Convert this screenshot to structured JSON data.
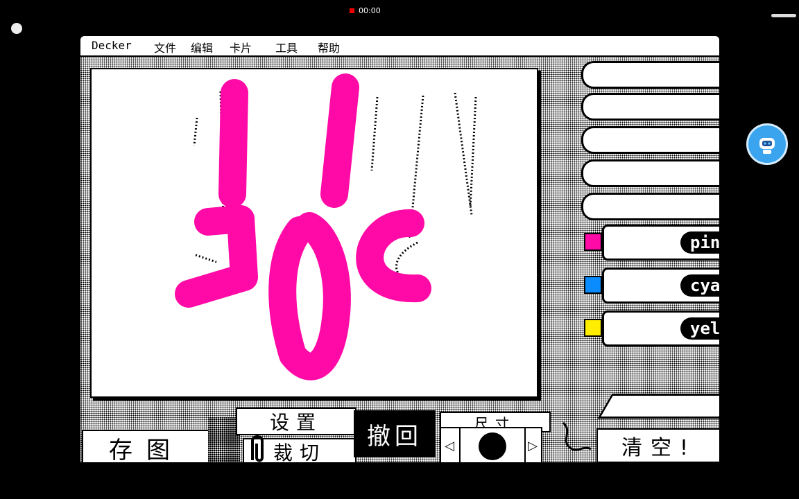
{
  "status_bar": {
    "recording_time": "00:00"
  },
  "app": {
    "menu": {
      "app_name": "Decker",
      "items": [
        "文件",
        "编辑",
        "卡片",
        "工具",
        "帮助"
      ]
    },
    "markers": [
      {
        "label": "pink",
        "color": "#ff0aa6"
      },
      {
        "label": "cyan",
        "color": "#0a8cff"
      },
      {
        "label": "yellow",
        "color": "#ffee00"
      }
    ],
    "buttons": {
      "save": "存图",
      "settings": "设置",
      "crop": "裁切",
      "undo": "撤回",
      "size": "尺寸",
      "clear": "清空!"
    },
    "tools": [
      "fountain-pen-icon",
      "pencil-icon",
      "brush-icon",
      "ink-brush-icon",
      "spray-pen-icon",
      "pink-marker",
      "cyan-marker",
      "yellow-marker",
      "eraser-icon"
    ],
    "drawing": {
      "stroke_color": "#ff0aa6"
    }
  }
}
